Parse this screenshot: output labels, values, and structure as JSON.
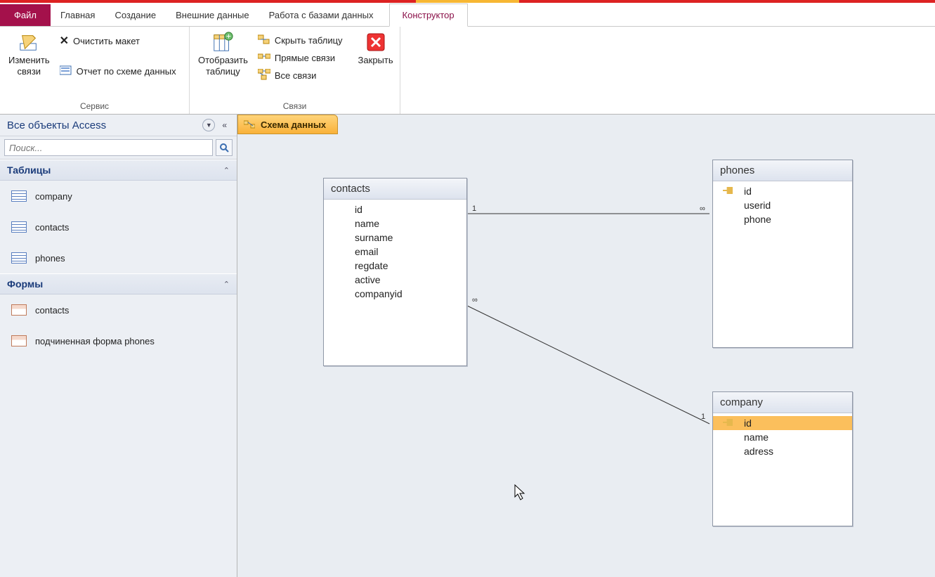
{
  "tabs": {
    "file": "Файл",
    "home": "Главная",
    "create": "Создание",
    "external": "Внешние данные",
    "dbtools": "Работа с базами данных",
    "konstruktor": "Конструктор"
  },
  "ribbon": {
    "service": {
      "label": "Сервис",
      "editrel": "Изменить\nсвязи",
      "clear": "Очистить макет",
      "report": "Отчет по схеме данных"
    },
    "links": {
      "label": "Связи",
      "showtable": "Отобразить\nтаблицу",
      "hidetable": "Скрыть таблицу",
      "direct": "Прямые связи",
      "all": "Все связи",
      "close": "Закрыть"
    }
  },
  "nav": {
    "title": "Все объекты Access",
    "search_placeholder": "Поиск...",
    "cat_tables": "Таблицы",
    "cat_forms": "Формы",
    "tables": [
      "company",
      "contacts",
      "phones"
    ],
    "forms": [
      "contacts",
      "подчиненная форма phones"
    ]
  },
  "doc": {
    "tab": "Схема данных"
  },
  "diagram": {
    "contacts": {
      "title": "contacts",
      "fields": [
        "id",
        "name",
        "surname",
        "email",
        "regdate",
        "active",
        "companyid"
      ]
    },
    "phones": {
      "title": "phones",
      "fields": [
        "id",
        "userid",
        "phone"
      ]
    },
    "company": {
      "title": "company",
      "fields": [
        "id",
        "name",
        "adress"
      ]
    }
  },
  "rel": {
    "one": "1",
    "many": "∞"
  }
}
